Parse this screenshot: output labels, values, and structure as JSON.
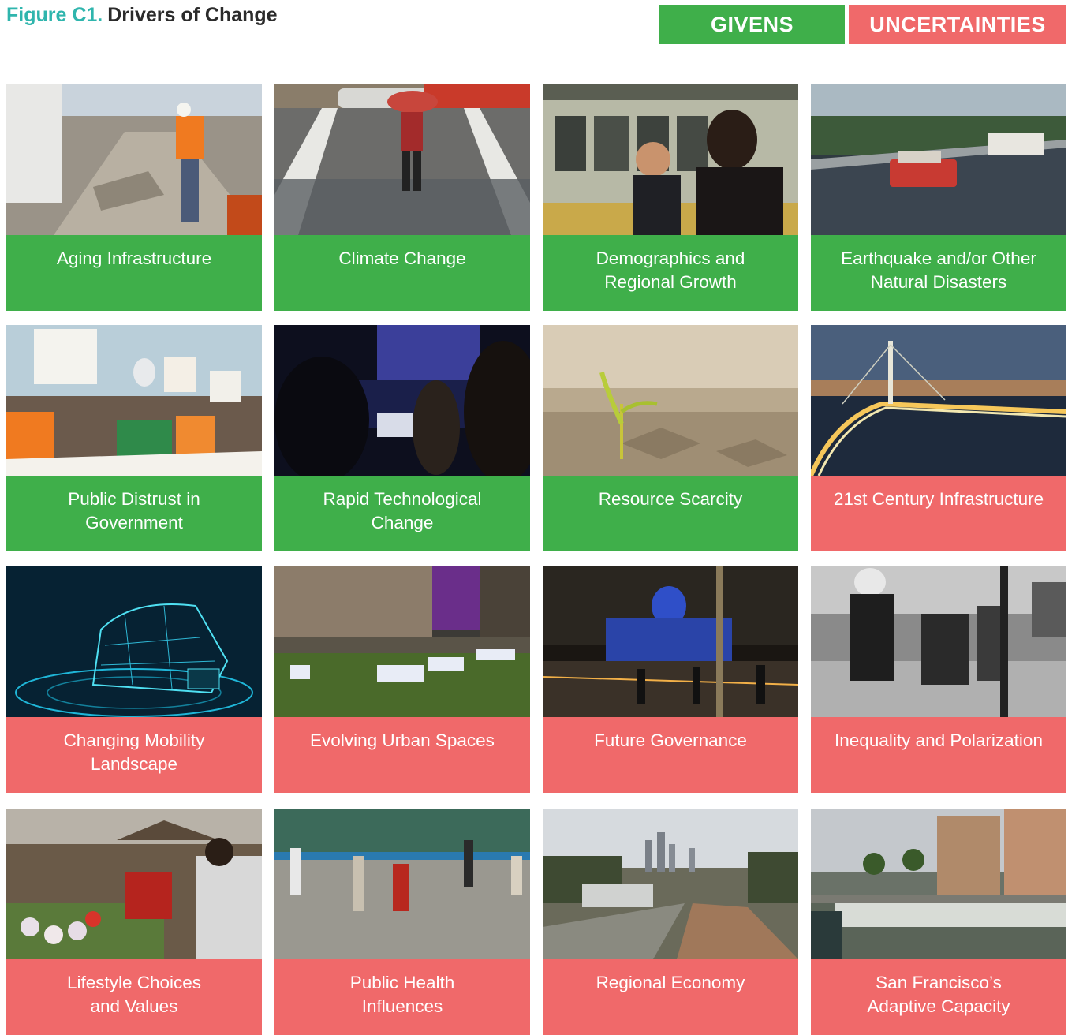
{
  "figure": {
    "label": "Figure C1.",
    "title": "Drivers of Change"
  },
  "legend": {
    "givens": "GIVENS",
    "uncertainties": "UNCERTAINTIES",
    "givens_color": "#3faf4a",
    "uncertainties_color": "#f0696a"
  },
  "cards": [
    {
      "line1": "Aging Infrastructure",
      "line2": "",
      "category": "given",
      "photo": "road-construction-worker-image"
    },
    {
      "line1": "Climate Change",
      "line2": "",
      "category": "given",
      "photo": "flooded-street-umbrella-image"
    },
    {
      "line1": "Demographics and",
      "line2": "Regional Growth",
      "category": "given",
      "photo": "train-platform-mother-child-image"
    },
    {
      "line1": "Earthquake and/or Other",
      "line2": "Natural Disasters",
      "category": "given",
      "photo": "collapsed-freeway-image"
    },
    {
      "line1": "Public Distrust in",
      "line2": "Government",
      "category": "given",
      "photo": "protest-march-image"
    },
    {
      "line1": "Rapid Technological",
      "line2": "Change",
      "category": "given",
      "photo": "tech-event-audience-image"
    },
    {
      "line1": "Resource Scarcity",
      "line2": "",
      "category": "given",
      "photo": "seedling-dry-soil-image"
    },
    {
      "line1": "21st Century Infrastructure",
      "line2": "",
      "category": "uncertainty",
      "photo": "bay-bridge-night-image"
    },
    {
      "line1": "Changing Mobility",
      "line2": "Landscape",
      "category": "uncertainty",
      "photo": "wireframe-car-image"
    },
    {
      "line1": "Evolving Urban Spaces",
      "line2": "",
      "category": "uncertainty",
      "photo": "urban-plaza-seating-image"
    },
    {
      "line1": "Future Governance",
      "line2": "",
      "category": "uncertainty",
      "photo": "city-hall-night-image"
    },
    {
      "line1": "Inequality and Polarization",
      "line2": "",
      "category": "uncertainty",
      "photo": "police-protesters-image"
    },
    {
      "line1": "Lifestyle Choices",
      "line2": "and Values",
      "category": "uncertainty",
      "photo": "farmers-market-image"
    },
    {
      "line1": "Public Health",
      "line2": "Influences",
      "category": "uncertainty",
      "photo": "tai-chi-park-image"
    },
    {
      "line1": "Regional Economy",
      "line2": "",
      "category": "uncertainty",
      "photo": "bart-train-skyline-image"
    },
    {
      "line1": "San Francisco’s",
      "line2": "Adaptive Capacity",
      "category": "uncertainty",
      "photo": "waterfront-seawall-image"
    }
  ]
}
